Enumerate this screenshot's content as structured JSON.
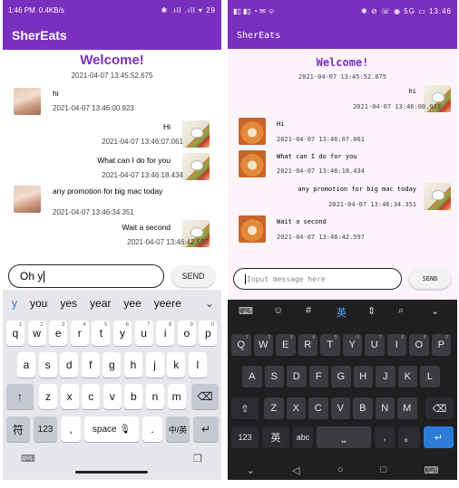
{
  "left": {
    "status": {
      "time": "1:46 PM",
      "speed": "0.4KB/s",
      "right": "✱ .ıll .ıll ▾ 29"
    },
    "appbar": {
      "title": "SherEats"
    },
    "chat": {
      "welcome": "Welcome!",
      "welcome_time": "2021-04-07 13:45:52.675",
      "messages": [
        {
          "side": "left",
          "text": "hi",
          "time": "2021-04-07 13:46:00.923"
        },
        {
          "side": "right",
          "text": "Hi",
          "time": "2021-04-07 13:46:07.061"
        },
        {
          "side": "right",
          "text": "What can I do for you",
          "time": "2021-04-07 13:46:18.434"
        },
        {
          "side": "left",
          "text": "any promotion for big mac today",
          "text_line2": "today",
          "time": "2021-04-07 13:46:34.351"
        },
        {
          "side": "right",
          "text": "Wait a second",
          "time": "2021-04-07 13:46:42.597"
        }
      ]
    },
    "input": {
      "value": "Oh y",
      "send": "SEND"
    },
    "keyboard": {
      "suggestions": [
        "y",
        "you",
        "yes",
        "year",
        "yee",
        "yeere"
      ],
      "row1": [
        "q",
        "w",
        "e",
        "r",
        "t",
        "y",
        "u",
        "i",
        "o",
        "p"
      ],
      "row1_sup": [
        "1",
        "2",
        "3",
        "4",
        "5",
        "6",
        "7",
        "8",
        "9",
        "0"
      ],
      "row2": [
        "a",
        "s",
        "d",
        "f",
        "g",
        "h",
        "j",
        "k",
        "l"
      ],
      "row3": [
        "z",
        "x",
        "c",
        "v",
        "b",
        "n",
        "m"
      ],
      "bottom": {
        "lang": "符",
        "num": "123",
        "comma": ",",
        "space": "space",
        "period": ".",
        "enter": "↵",
        "zh": "中/英"
      }
    }
  },
  "right": {
    "status": {
      "left": "▮▯ ▮▯ ◔ ✉ ☺",
      "right": "✱ ⊘ ☏ ◉ 5G ▭ 13:46"
    },
    "appbar": {
      "title": "SherEats"
    },
    "chat": {
      "welcome": "Welcome!",
      "welcome_time": "2021-04-07 13:45:52.675",
      "messages": [
        {
          "side": "right",
          "text": "hi",
          "time": "2021-04-07 13:46:00.923"
        },
        {
          "side": "left",
          "text": "Hi",
          "time": "2021-04-07 13:46:07.061"
        },
        {
          "side": "left",
          "text": "What can I do for you",
          "time": "2021-04-07 13:46:18.434"
        },
        {
          "side": "right",
          "text": "any promotion for big mac today",
          "time": "2021-04-07 13:46:34.351"
        },
        {
          "side": "left",
          "text": "Wait a second",
          "time": "2021-04-07 13:46:42.597"
        }
      ]
    },
    "input": {
      "placeholder": "Input message here",
      "send": "SEND"
    },
    "keyboard": {
      "row1": [
        "Q",
        "W",
        "E",
        "R",
        "T",
        "Y",
        "U",
        "I",
        "O",
        "P"
      ],
      "row1_sup": [
        "1",
        "2",
        "3",
        "4",
        "5",
        "6",
        "7",
        "8",
        "9",
        "0"
      ],
      "row2": [
        "A",
        "S",
        "D",
        "F",
        "G",
        "H",
        "J",
        "K",
        "L"
      ],
      "row3": [
        "Z",
        "X",
        "C",
        "V",
        "B",
        "N",
        "M"
      ],
      "bottom": {
        "num": "123",
        "zh": "英",
        "abc": "abc",
        "comma": ",",
        "period": "。"
      }
    }
  }
}
